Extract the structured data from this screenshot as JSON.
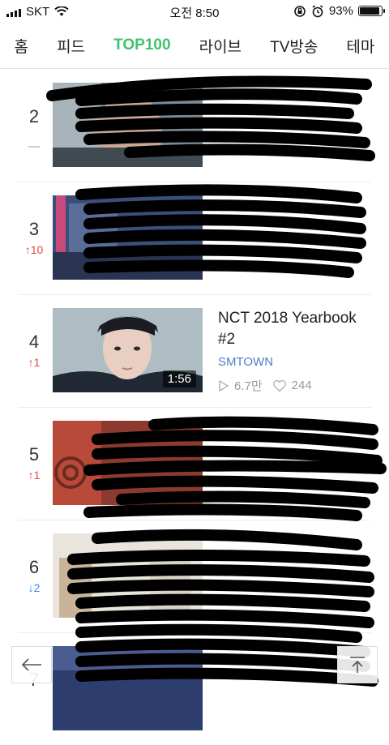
{
  "status_bar": {
    "carrier": "SKT",
    "time": "오전 8:50",
    "battery": "93%",
    "battery_level": 0.93
  },
  "tabs": [
    {
      "label": "홈",
      "active": false
    },
    {
      "label": "피드",
      "active": false
    },
    {
      "label": "TOP100",
      "active": true
    },
    {
      "label": "라이브",
      "active": false
    },
    {
      "label": "TV방송",
      "active": false
    },
    {
      "label": "테마",
      "active": false
    }
  ],
  "accent_color": "#3ec46d",
  "rows": [
    {
      "rank": "2",
      "change": "",
      "change_dir": "same"
    },
    {
      "rank": "3",
      "change": "10",
      "change_dir": "up"
    },
    {
      "rank": "4",
      "change": "1",
      "change_dir": "up",
      "title": "NCT 2018 Yearbook #2",
      "artist": "SMTOWN",
      "views": "6.7만",
      "likes": "244",
      "duration": "1:56"
    },
    {
      "rank": "5",
      "change": "1",
      "change_dir": "up"
    },
    {
      "rank": "6",
      "change": "2",
      "change_dir": "down"
    },
    {
      "rank": "7",
      "change": "",
      "change_dir": "same"
    }
  ],
  "icons": {
    "back": "arrow-left-icon",
    "scroll_top": "scroll-to-top-icon",
    "play": "play-icon",
    "heart": "heart-icon"
  }
}
